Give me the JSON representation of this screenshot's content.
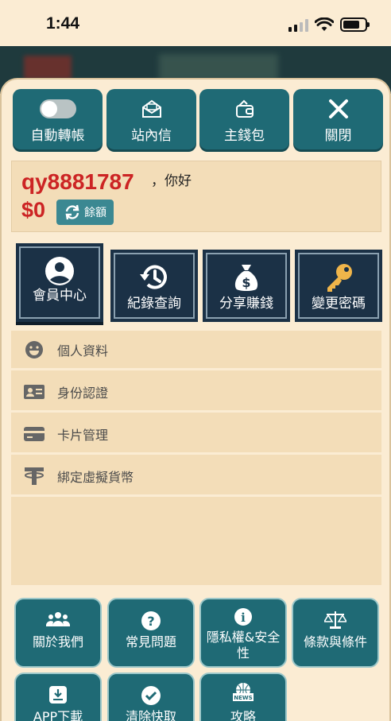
{
  "status_bar": {
    "time": "1:44"
  },
  "top_actions": [
    {
      "label": "自動轉帳",
      "icon": "toggle-icon"
    },
    {
      "label": "站內信",
      "icon": "mail-icon"
    },
    {
      "label": "主錢包",
      "icon": "wallet-icon"
    },
    {
      "label": "關閉",
      "icon": "close-icon"
    }
  ],
  "user": {
    "username": "qy8881787",
    "greeting": "，你好",
    "balance": "$0",
    "refresh_label": "餘額"
  },
  "member_tabs": [
    {
      "label": "會員中心",
      "icon": "user-icon",
      "active": true
    },
    {
      "label": "紀錄查詢",
      "icon": "history-icon",
      "active": false
    },
    {
      "label": "分享賺錢",
      "icon": "money-bag-icon",
      "active": false
    },
    {
      "label": "變更密碼",
      "icon": "key-icon",
      "active": false
    }
  ],
  "menu_items": [
    {
      "label": "個人資料",
      "icon": "smiley-icon"
    },
    {
      "label": "身份認證",
      "icon": "id-card-icon"
    },
    {
      "label": "卡片管理",
      "icon": "credit-card-icon"
    },
    {
      "label": "綁定虛擬貨幣",
      "icon": "tether-icon"
    }
  ],
  "bottom_buttons": [
    {
      "label": "關於我們",
      "icon": "users-icon"
    },
    {
      "label": "常見問題",
      "icon": "question-icon"
    },
    {
      "label": "隱私權&安全性",
      "icon": "info-icon"
    },
    {
      "label": "條款與條件",
      "icon": "scale-icon"
    },
    {
      "label": "APP下載",
      "icon": "download-icon"
    },
    {
      "label": "清除快取",
      "icon": "check-icon"
    },
    {
      "label": "攻略",
      "icon": "news-icon"
    }
  ],
  "colors": {
    "background": "#fbecd3",
    "teal_button": "#1f6a75",
    "navy_tab": "#1b3146",
    "username_red": "#cc2424"
  }
}
